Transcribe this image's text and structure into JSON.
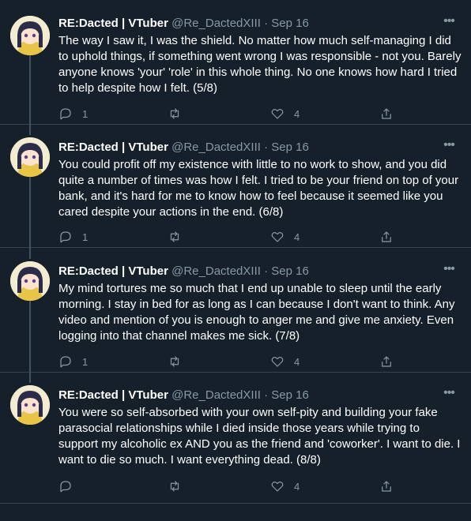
{
  "author": {
    "name": "RE:Dacted | VTuber",
    "handle": "@Re_DactedXIII",
    "separator": "·"
  },
  "more_label": "•••",
  "tweets": [
    {
      "date": "Sep 16",
      "text": "The way I saw it, I was the shield. No matter how much self-managing I did to uphold things, if something went wrong I was responsible - not you. Barely anyone knows 'your' 'role' in this whole thing. No one knows how hard I tried to help despite how I felt. (5/8)",
      "replies": "1",
      "retweets": "",
      "likes": "4"
    },
    {
      "date": "Sep 16",
      "text": "You could profit off my existence with little to no work to show, and you did quite a number of times was how I felt. I tried to be your friend on top of your bank, and it's hard for me to know how to feel because it seemed like you cared despite your actions in the end. (6/8)",
      "replies": "1",
      "retweets": "",
      "likes": "4"
    },
    {
      "date": "Sep 16",
      "text": "My mind tortures me so much that I end up unable to sleep until the early morning. I stay in bed for as long as I can because I don't want to think. Any video and mention of you is enough to anger me and give me anxiety. Even logging into that channel makes me sick. (7/8)",
      "replies": "1",
      "retweets": "",
      "likes": "4"
    },
    {
      "date": "Sep 16",
      "text": "You were so self-absorbed with your own self-pity and building your fake parasocial relationships while I died inside those years while trying to support my alcoholic ex AND you as the friend and 'coworker'. I want to die. I want to die so much. I want everything dead. (8/8)",
      "replies": "",
      "retweets": "",
      "likes": "4"
    }
  ],
  "colors": {
    "background": "#15202b",
    "text": "#ffffff",
    "secondary": "#8899a6",
    "border": "#38444d"
  }
}
